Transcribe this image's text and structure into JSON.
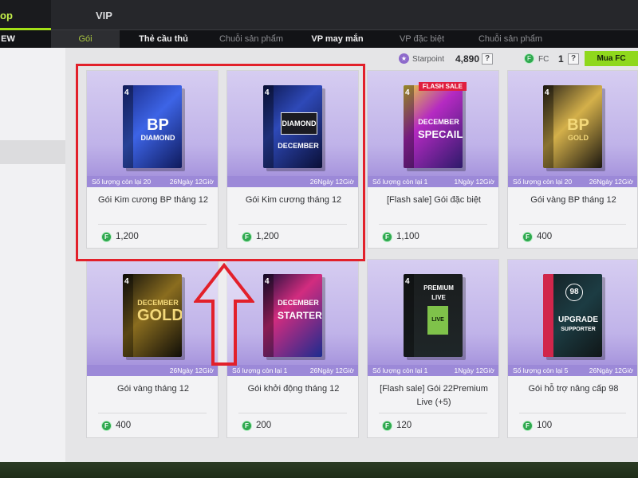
{
  "tabs": {
    "shop": "op",
    "vip": "VIP"
  },
  "subnav": [
    "EW",
    "Gói",
    "Thẻ cầu thủ",
    "Chuỗi sản phẩm",
    "VP may mắn",
    "VP đặc biệt",
    "Chuỗi sản phẩm"
  ],
  "currency": {
    "starpoint_label": "Starpoint",
    "starpoint_value": "4,890",
    "fc_label": "FC",
    "fc_value": "1",
    "plus": "?",
    "buy_fc": "Mua FC"
  },
  "cards": [
    {
      "strip_left": "Số lượng còn lại 20",
      "strip_right": "26Ngày 12Giờ",
      "title": "Gói Kim cương BP tháng 12",
      "price": "1,200",
      "pack_l1": "BP",
      "pack_l2": "DIAMOND"
    },
    {
      "strip_left": "",
      "strip_right": "26Ngày 12Giờ",
      "title": "Gói Kim cương tháng 12",
      "price": "1,200",
      "pack_l1": "DIAMOND",
      "pack_l2": "DECEMBER"
    },
    {
      "strip_left": "Số lượng còn lại 1",
      "strip_right": "1Ngày 12Giờ",
      "title": "[Flash sale] Gói đặc biệt",
      "price": "1,100",
      "pack_l1": "SPECAIL",
      "pack_l2": "DECEMBER",
      "flash": "FLASH SALE"
    },
    {
      "strip_left": "Số lượng còn lại 20",
      "strip_right": "26Ngày 12Giờ",
      "title": "Gói vàng BP tháng 12",
      "price": "400",
      "pack_l1": "BP",
      "pack_l2": "GOLD"
    },
    {
      "strip_left": "",
      "strip_right": "26Ngày 12Giờ",
      "title": "Gói vàng tháng 12",
      "price": "400",
      "pack_l1": "GOLD",
      "pack_l2": "DECEMBER"
    },
    {
      "strip_left": "Số lượng còn lại 1",
      "strip_right": "26Ngày 12Giờ",
      "title": "Gói khởi động tháng 12",
      "price": "200",
      "pack_l1": "STARTER",
      "pack_l2": "DECEMBER"
    },
    {
      "strip_left": "Số lượng còn lại 1",
      "strip_right": "1Ngày 12Giờ",
      "title": "[Flash sale] Gói 22Premium Live (+5)",
      "price": "120",
      "pack_l1": "PREMIUM LIVE",
      "pack_l2": "LIVE"
    },
    {
      "strip_left": "Số lượng còn lại 5",
      "strip_right": "26Ngày 12Giờ",
      "title": "Gói hỗ trợ nâng cấp 98",
      "price": "100",
      "pack_l1": "UPGRADE",
      "pack_l2": "SUPPORTER"
    }
  ],
  "colors": {
    "accent": "#a3e017",
    "strip": "#9c89d8",
    "highlight": "#e2202a",
    "coin": "#2fa84f"
  }
}
